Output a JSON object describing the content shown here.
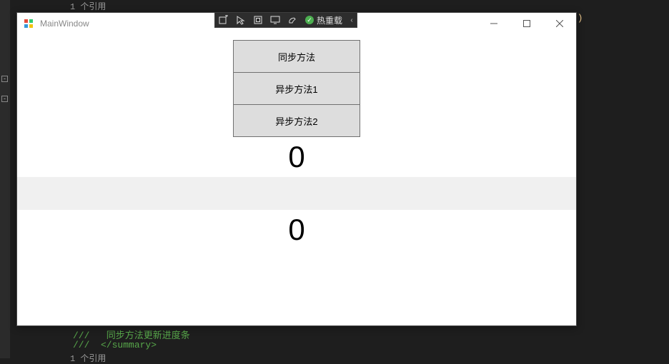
{
  "bg": {
    "ref_top": "1 个引用",
    "ref_bottom": "1 个引用",
    "comment_line1": "///   同步方法更新进度条",
    "comment_line2": "///  </summary>",
    "paren": "e)"
  },
  "window": {
    "title": "MainWindow"
  },
  "debug_toolbar": {
    "hot_reload": "热重载"
  },
  "buttons": {
    "b1": "同步方法",
    "b2": "异步方法1",
    "b3": "异步方法2"
  },
  "counters": {
    "c1": "0",
    "c2": "0"
  }
}
